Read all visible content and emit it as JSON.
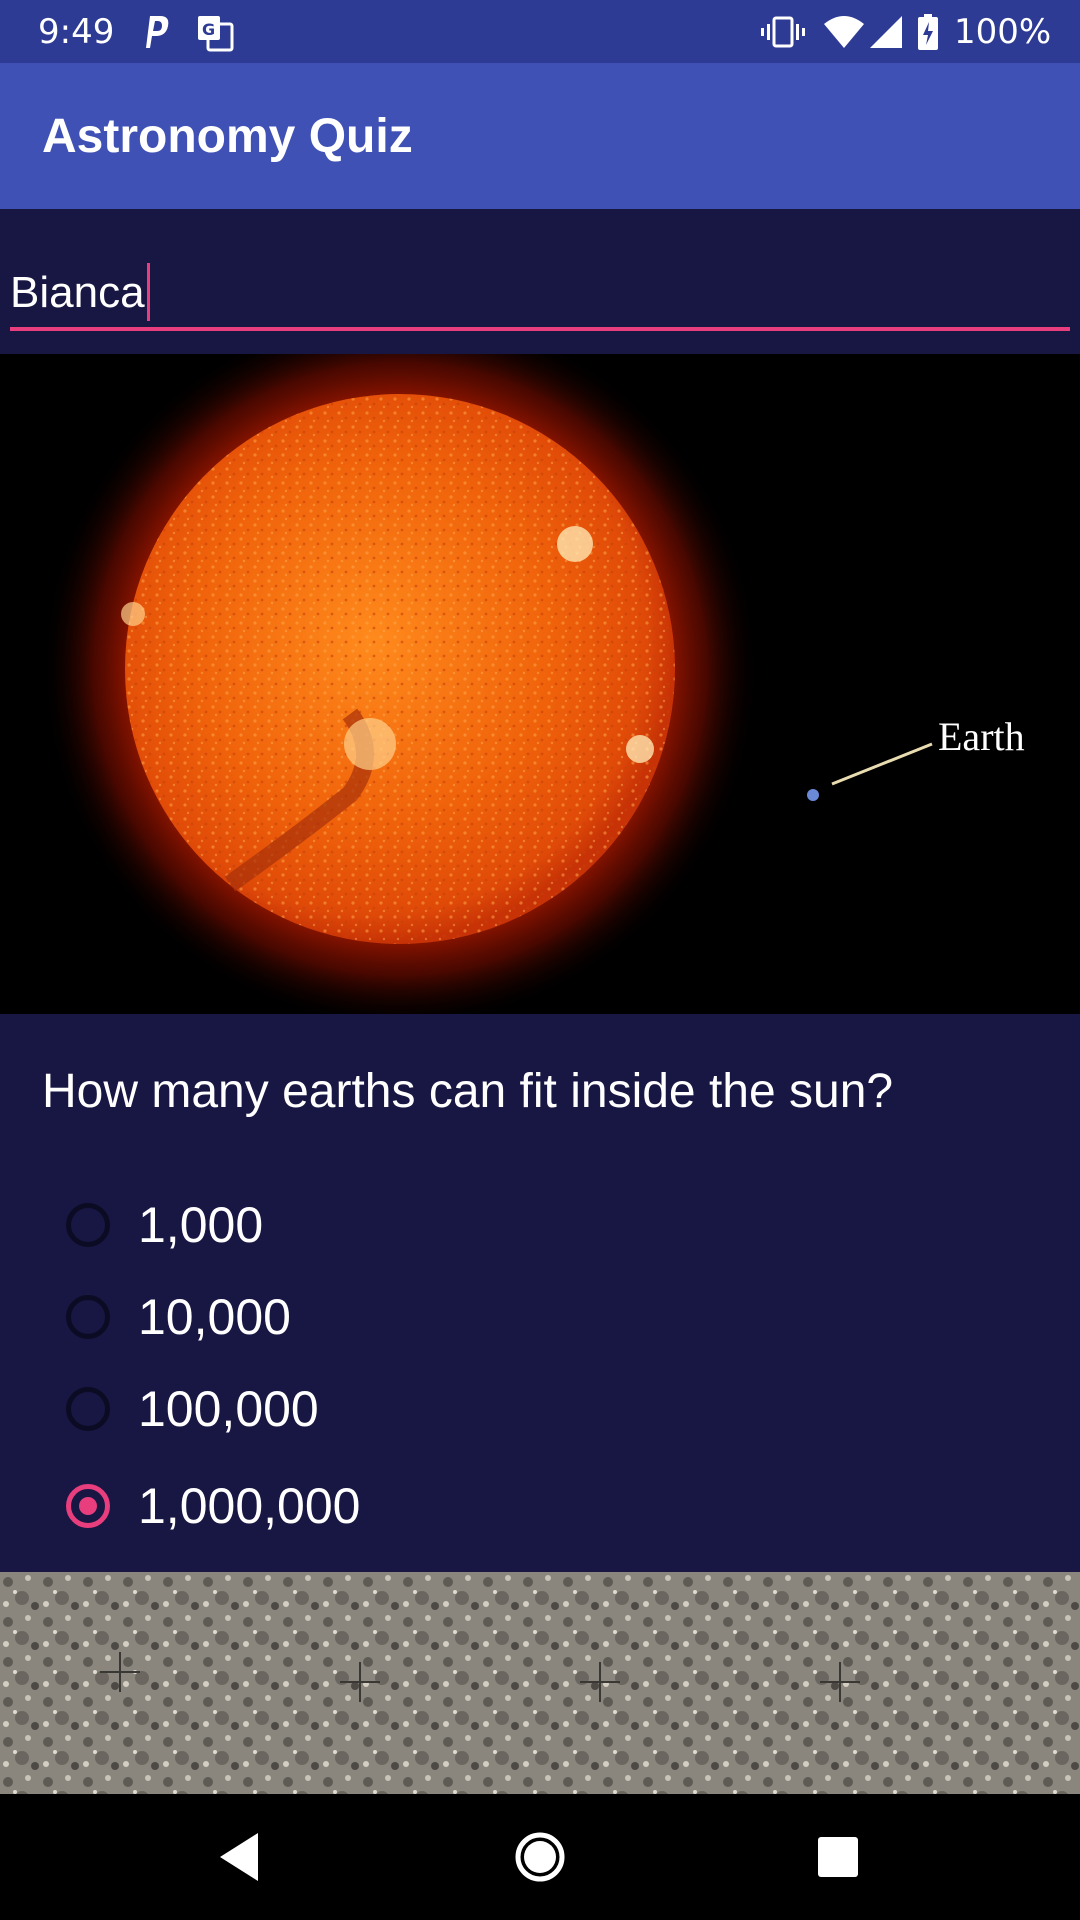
{
  "status_bar": {
    "time": "9:49",
    "battery": "100%",
    "icons": [
      "parking-icon",
      "translate-icon",
      "vibrate-icon",
      "wifi-icon",
      "signal-icon",
      "battery-charging-icon"
    ]
  },
  "app_bar": {
    "title": "Astronomy Quiz",
    "color": "#3f51b5"
  },
  "name_input": {
    "value": "Bianca",
    "accent": "#e83e7e"
  },
  "image": {
    "earth_label": "Earth"
  },
  "quiz": {
    "question": "How many earths can fit inside the sun?",
    "options": [
      {
        "label": "1,000",
        "selected": false
      },
      {
        "label": "10,000",
        "selected": false
      },
      {
        "label": "100,000",
        "selected": false
      },
      {
        "label": "1,000,000",
        "selected": true
      }
    ]
  },
  "nav_bar": {
    "icons": [
      "back-icon",
      "home-icon",
      "recents-icon"
    ]
  }
}
